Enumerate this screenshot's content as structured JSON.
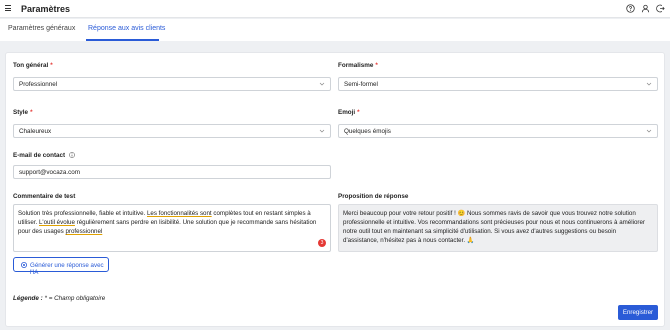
{
  "header": {
    "title": "Paramètres",
    "icons": [
      "menu-icon",
      "help-icon",
      "user-icon",
      "logout-icon"
    ]
  },
  "tabs": [
    {
      "label": "Paramètres généraux",
      "active": false
    },
    {
      "label": "Réponse aux avis clients",
      "active": true
    }
  ],
  "form": {
    "tone": {
      "label": "Ton général",
      "value": "Professionnel",
      "required": "*"
    },
    "formality": {
      "label": "Formalisme",
      "value": "Semi-formel",
      "required": "*"
    },
    "style": {
      "label": "Style",
      "value": "Chaleureux",
      "required": "*"
    },
    "emoji": {
      "label": "Emoji",
      "value": "Quelques émojis",
      "required": "*"
    },
    "email": {
      "label": "E-mail de contact",
      "value": "support@vocaza.com"
    },
    "test_comment": {
      "label": "Commentaire de test",
      "part1": "Solution très professionnelle, fiable et intuitive. ",
      "part2": "Les fonctionnalités sont",
      "part3": " complètes tout en restant simples à utiliser. ",
      "part4": "L'outil évolue",
      "part5": " régulièrement sans perdre en lisibilité. Une solution que je recommande sans hésitation pour des usages ",
      "part6": "professionnel",
      "issue_count": "3"
    },
    "proposal": {
      "label": "Proposition de réponse",
      "text": "Merci beaucoup pour votre retour positif ! 😊 Nous sommes ravis de savoir que vous trouvez notre solution professionnelle et intuitive. Vos recommandations sont précieuses pour nous et nous continuerons à améliorer notre outil tout en maintenant sa simplicité d'utilisation. Si vous avez d'autres suggestions ou besoin d'assistance, n'hésitez pas à nous contacter. 🙏"
    },
    "generate_button": "Générer une réponse avec l'IA",
    "legend_label": "Légende :",
    "legend_text": " * = Champ obligatoire",
    "save_button": "Enregistrer"
  },
  "colors": {
    "accent": "#2a5bd7",
    "required": "#e53935"
  }
}
